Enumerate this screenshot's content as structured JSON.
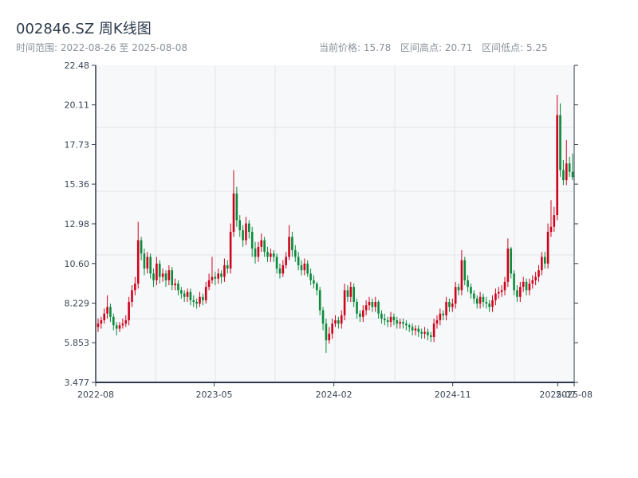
{
  "header": {
    "title": "002846.SZ 周K线图",
    "range_text": "时间范围: 2022-08-26 至 2025-08-08",
    "current_price": "当前价格: 15.78",
    "range_high": "区间高点: 20.71",
    "range_low": "区间低点: 5.25"
  },
  "chart_data": {
    "type": "candlestick",
    "title": "002846.SZ 周K线图",
    "interval": "weekly",
    "start_date": "2022-08-26",
    "end_date": "2025-08-08",
    "ylim": [
      3.477,
      22.48
    ],
    "y_ticks": [
      "22.48",
      "20.11",
      "17.73",
      "15.36",
      "12.98",
      "10.60",
      "8.229",
      "5.853",
      "3.477"
    ],
    "x_ticks": [
      {
        "label": "2022-08",
        "date": "2022-08-01"
      },
      {
        "label": "2023-05",
        "date": "2023-05-01"
      },
      {
        "label": "2024-02",
        "date": "2024-02-01"
      },
      {
        "label": "2024-11",
        "date": "2024-11-01"
      },
      {
        "label": "2025-07",
        "date": "2025-07-01"
      },
      {
        "label": "2025-08",
        "date": "2025-08-08"
      }
    ],
    "x_domain": [
      "2022-08-01",
      "2025-08-08"
    ],
    "grid": true,
    "up_color": "#d0021b",
    "down_color": "#0a8a3a",
    "close": [
      7.0,
      7.2,
      7.6,
      8.0,
      7.4,
      6.9,
      6.7,
      6.9,
      7.0,
      7.2,
      8.3,
      9.0,
      9.4,
      12.0,
      11.2,
      10.3,
      11.0,
      10.0,
      9.6,
      10.6,
      9.8,
      10.0,
      9.6,
      10.2,
      9.3,
      9.4,
      9.0,
      8.8,
      8.6,
      8.9,
      8.4,
      8.3,
      8.2,
      8.6,
      8.4,
      9.2,
      9.6,
      9.8,
      9.7,
      10.0,
      9.8,
      10.5,
      10.3,
      12.5,
      14.8,
      13.2,
      12.6,
      12.0,
      13.0,
      12.5,
      11.5,
      11.0,
      11.6,
      12.0,
      11.3,
      11.0,
      11.2,
      11.0,
      10.3,
      10.0,
      10.5,
      11.0,
      12.2,
      11.4,
      11.0,
      10.5,
      10.2,
      10.6,
      10.0,
      9.6,
      9.4,
      9.0,
      7.8,
      7.0,
      6.0,
      6.4,
      7.0,
      7.2,
      7.0,
      7.5,
      9.0,
      8.6,
      9.2,
      8.3,
      7.6,
      7.4,
      7.8,
      8.1,
      8.3,
      8.0,
      8.3,
      7.6,
      7.3,
      7.2,
      7.1,
      7.4,
      7.2,
      7.0,
      7.1,
      7.0,
      6.9,
      6.8,
      6.6,
      6.7,
      6.5,
      6.4,
      6.5,
      6.3,
      6.2,
      7.0,
      7.2,
      7.6,
      7.5,
      8.3,
      8.0,
      8.2,
      9.2,
      9.0,
      10.8,
      9.6,
      9.2,
      8.8,
      8.5,
      8.2,
      8.6,
      8.3,
      8.2,
      8.0,
      8.4,
      8.8,
      8.9,
      9.0,
      9.5,
      11.5,
      10.0,
      9.0,
      8.6,
      9.2,
      9.5,
      9.0,
      9.4,
      9.6,
      9.8,
      10.2,
      11.0,
      10.6,
      12.5,
      12.8,
      13.5,
      19.5,
      16.2,
      15.6,
      16.6,
      16.1,
      15.78
    ],
    "open": [
      6.8,
      7.0,
      7.2,
      7.6,
      8.0,
      7.4,
      6.9,
      6.7,
      6.9,
      7.0,
      7.2,
      8.3,
      9.0,
      9.4,
      12.0,
      11.2,
      10.3,
      11.0,
      10.0,
      9.6,
      10.6,
      9.8,
      10.0,
      9.6,
      10.2,
      9.3,
      9.4,
      9.0,
      8.8,
      8.6,
      8.9,
      8.4,
      8.3,
      8.2,
      8.6,
      8.4,
      9.2,
      9.6,
      9.8,
      9.7,
      10.0,
      9.8,
      10.5,
      10.3,
      12.5,
      14.8,
      13.2,
      12.6,
      12.0,
      13.0,
      12.5,
      11.5,
      11.0,
      11.6,
      12.0,
      11.3,
      11.0,
      11.2,
      11.0,
      10.3,
      10.0,
      10.5,
      11.0,
      12.2,
      11.4,
      11.0,
      10.5,
      10.2,
      10.6,
      10.0,
      9.6,
      9.4,
      9.0,
      7.8,
      7.0,
      6.0,
      6.4,
      7.0,
      7.2,
      7.0,
      7.5,
      9.0,
      8.6,
      9.2,
      8.3,
      7.6,
      7.4,
      7.8,
      8.1,
      8.3,
      8.0,
      8.3,
      7.6,
      7.3,
      7.2,
      7.1,
      7.4,
      7.2,
      7.0,
      7.1,
      7.0,
      6.9,
      6.8,
      6.6,
      6.7,
      6.5,
      6.4,
      6.5,
      6.3,
      6.2,
      7.0,
      7.2,
      7.6,
      7.5,
      8.3,
      8.0,
      8.2,
      9.2,
      9.0,
      10.8,
      9.6,
      9.2,
      8.8,
      8.5,
      8.2,
      8.6,
      8.3,
      8.2,
      8.0,
      8.4,
      8.8,
      8.9,
      9.0,
      9.5,
      11.5,
      10.0,
      9.0,
      8.6,
      9.2,
      9.5,
      9.0,
      9.4,
      9.6,
      9.8,
      10.2,
      11.0,
      10.6,
      12.5,
      12.8,
      13.5,
      19.5,
      16.2,
      15.6,
      16.6,
      16.1
    ],
    "high": [
      7.3,
      7.4,
      7.9,
      8.7,
      8.2,
      7.6,
      7.1,
      7.1,
      7.3,
      7.5,
      8.6,
      9.3,
      9.8,
      13.1,
      12.2,
      11.5,
      11.3,
      11.2,
      10.3,
      11.0,
      10.8,
      10.3,
      10.2,
      10.5,
      10.4,
      9.7,
      9.6,
      9.2,
      9.0,
      9.1,
      9.1,
      8.7,
      8.5,
      8.9,
      8.8,
      9.5,
      10.0,
      11.0,
      10.1,
      10.3,
      10.2,
      10.9,
      10.8,
      13.0,
      16.2,
      15.2,
      13.5,
      12.9,
      13.4,
      13.2,
      12.8,
      11.9,
      11.9,
      12.4,
      12.2,
      11.6,
      11.5,
      11.4,
      11.2,
      10.6,
      10.8,
      11.3,
      12.9,
      12.5,
      11.7,
      11.3,
      10.8,
      10.9,
      10.8,
      10.3,
      9.9,
      9.5,
      9.2,
      8.0,
      7.3,
      6.8,
      7.3,
      7.5,
      7.4,
      7.8,
      9.4,
      9.3,
      9.5,
      9.4,
      8.5,
      7.8,
      8.1,
      8.4,
      8.6,
      8.5,
      8.6,
      8.4,
      7.8,
      7.6,
      7.4,
      7.7,
      7.6,
      7.4,
      7.3,
      7.3,
      7.2,
      7.0,
      7.0,
      6.9,
      6.9,
      6.7,
      6.8,
      6.7,
      6.5,
      7.3,
      7.5,
      7.9,
      7.8,
      8.6,
      8.5,
      8.5,
      9.5,
      9.4,
      11.4,
      11.0,
      9.9,
      9.4,
      9.0,
      8.7,
      8.9,
      8.8,
      8.6,
      8.4,
      8.7,
      9.1,
      9.2,
      9.3,
      9.8,
      12.1,
      11.6,
      10.2,
      9.3,
      9.5,
      9.8,
      9.7,
      9.7,
      9.9,
      10.1,
      10.5,
      11.3,
      11.3,
      13.0,
      14.4,
      14.0,
      20.71,
      20.2,
      16.8,
      18.0,
      17.0,
      17.2
    ],
    "low": [
      6.5,
      6.7,
      7.0,
      7.3,
      7.1,
      6.6,
      6.3,
      6.5,
      6.7,
      6.8,
      6.9,
      8.0,
      8.7,
      9.1,
      10.8,
      9.9,
      10.0,
      9.7,
      9.2,
      9.3,
      9.4,
      9.5,
      9.2,
      9.3,
      9.0,
      9.0,
      8.7,
      8.5,
      8.3,
      8.3,
      8.1,
      8.0,
      7.9,
      8.0,
      8.1,
      8.2,
      9.0,
      9.4,
      9.3,
      9.4,
      9.4,
      9.5,
      10.0,
      10.0,
      12.2,
      12.8,
      12.2,
      11.6,
      11.7,
      12.1,
      11.0,
      10.6,
      10.7,
      11.3,
      11.0,
      10.7,
      10.7,
      10.7,
      10.0,
      9.7,
      9.8,
      10.3,
      10.8,
      11.0,
      10.7,
      10.2,
      9.9,
      9.9,
      9.8,
      9.3,
      9.1,
      8.7,
      7.5,
      6.6,
      5.25,
      5.8,
      6.1,
      6.8,
      6.7,
      6.7,
      7.2,
      8.3,
      8.3,
      8.0,
      7.3,
      7.1,
      7.1,
      7.5,
      7.8,
      7.7,
      7.7,
      7.3,
      7.0,
      6.9,
      6.8,
      6.8,
      6.9,
      6.7,
      6.7,
      6.7,
      6.6,
      6.5,
      6.3,
      6.3,
      6.2,
      6.1,
      6.1,
      6.0,
      5.9,
      5.9,
      6.7,
      6.9,
      7.2,
      7.2,
      7.7,
      7.7,
      7.9,
      8.7,
      8.7,
      9.3,
      8.9,
      8.5,
      8.2,
      7.9,
      7.9,
      8.0,
      7.9,
      7.7,
      7.7,
      8.1,
      8.5,
      8.6,
      8.7,
      9.2,
      9.7,
      8.7,
      8.3,
      8.3,
      8.9,
      8.7,
      8.7,
      9.1,
      9.3,
      9.5,
      9.9,
      10.3,
      10.3,
      12.2,
      12.5,
      13.2,
      15.8,
      15.3,
      15.3,
      15.8,
      15.6
    ]
  }
}
